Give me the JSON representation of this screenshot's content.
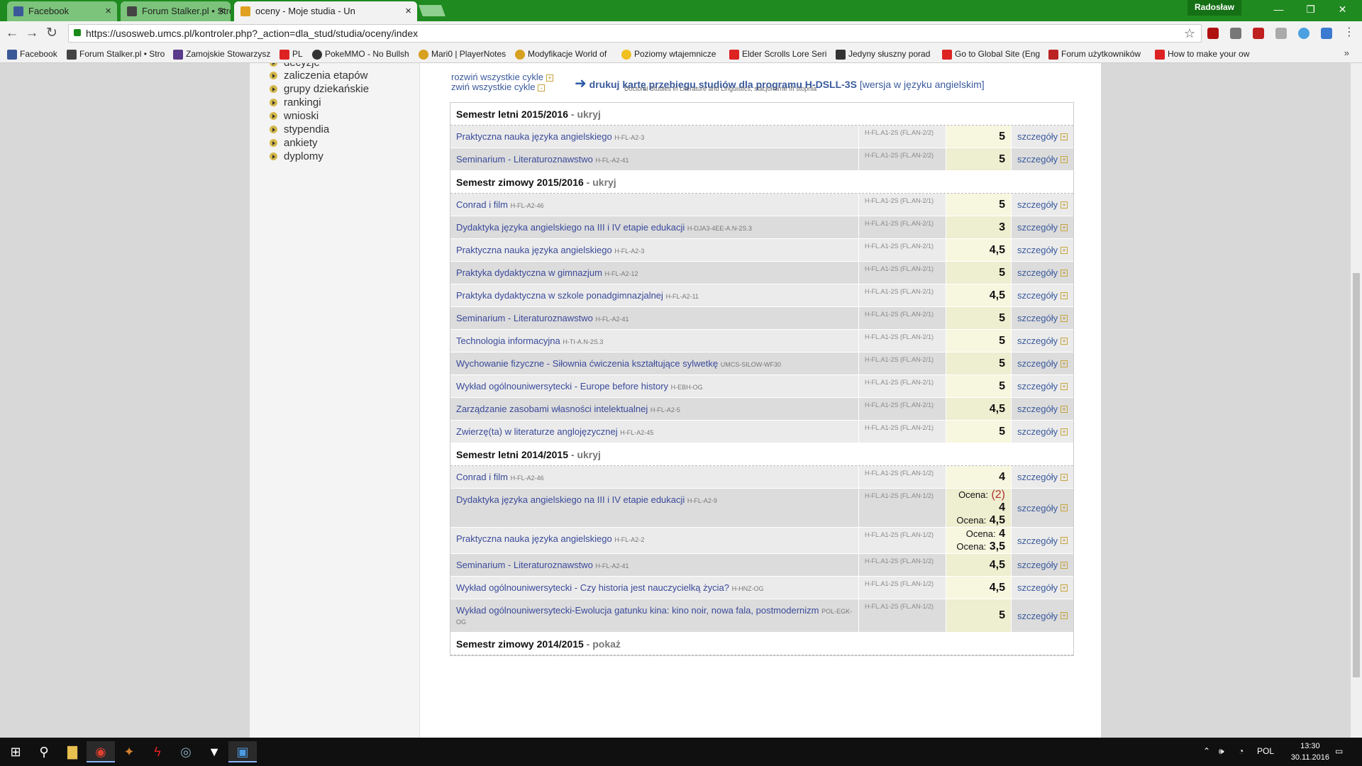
{
  "browser": {
    "tabs": [
      {
        "title": "Facebook",
        "icon_color": "#3b5998",
        "active": false
      },
      {
        "title": "Forum Stalker.pl • Strona",
        "icon_color": "#444444",
        "active": false
      },
      {
        "title": "oceny - Moje studia - Un",
        "icon_color": "#e0a020",
        "active": true
      }
    ],
    "user": "Radosław",
    "url": "https://usosweb.umcs.pl/kontroler.php?_action=dla_stud/studia/oceny/index",
    "bookmarks": [
      {
        "label": "Facebook",
        "color": "#3b5998"
      },
      {
        "label": "Forum Stalker.pl • Stro",
        "color": "#444444"
      },
      {
        "label": "Zamojskie Stowarzysz",
        "color": "#5a3a8a"
      },
      {
        "label": "PL",
        "color": "#d22"
      },
      {
        "label": "PokeMMO - No Bullsh",
        "color": "#333"
      },
      {
        "label": "Mari0 | PlayerNotes",
        "color": "#d8a020"
      },
      {
        "label": "Modyfikacje World of",
        "color": "#d8a020"
      },
      {
        "label": "Poziomy wtajemnicze",
        "color": "#f0c020"
      },
      {
        "label": "Elder Scrolls Lore Seri",
        "color": "#d22"
      },
      {
        "label": "Jedyny słuszny porad",
        "color": "#333"
      },
      {
        "label": "Go to Global Site (Eng",
        "color": "#d22"
      },
      {
        "label": "Forum użytkowników",
        "color": "#b22"
      },
      {
        "label": "How to make your ow",
        "color": "#d22"
      }
    ],
    "bookmarks_more": "»"
  },
  "sidebar": {
    "items": [
      {
        "label": "decyzje"
      },
      {
        "label": "zaliczenia etapów"
      },
      {
        "label": "grupy dziekańskie"
      },
      {
        "label": "rankingi"
      },
      {
        "label": "wnioski"
      },
      {
        "label": "stypendia"
      },
      {
        "label": "ankiety"
      },
      {
        "label": "dyplomy"
      }
    ]
  },
  "links": {
    "expand_all": "rozwiń wszystkie cykle",
    "collapse_all": "zwiń wszystkie cykle",
    "print_arrow": "➜",
    "print_main": "drukuj kartę przebiegu studiów dla programu H-DSLL-3S",
    "print_english": "[wersja w języku angielskim]",
    "print_sub": "Doctoral Studies in Literature and Linguistics, stacjonarne III stopnia"
  },
  "semesters": [
    {
      "title": "Semestr letni 2015/2016",
      "sep": " - ",
      "toggle": "ukryj",
      "courses": [
        {
          "name": "Praktyczna nauka języka angielskiego",
          "code": "H-FL-A2-3",
          "cycle": "H-FL.A1-2S (FL.AN-2/2)",
          "grades": [
            {
              "label": "",
              "value": "5"
            }
          ],
          "details": "szczegóły"
        },
        {
          "name": "Seminarium - Literaturoznawstwo",
          "code": "H-FL-A2-41",
          "cycle": "H-FL.A1-2S (FL.AN-2/2)",
          "grades": [
            {
              "label": "",
              "value": "5"
            }
          ],
          "details": "szczegóły"
        }
      ]
    },
    {
      "title": "Semestr zimowy 2015/2016",
      "sep": " - ",
      "toggle": "ukryj",
      "courses": [
        {
          "name": "Conrad i film",
          "code": "H-FL-A2-46",
          "cycle": "H-FL.A1-2S (FL.AN-2/1)",
          "grades": [
            {
              "label": "",
              "value": "5"
            }
          ],
          "details": "szczegóły"
        },
        {
          "name": "Dydaktyka języka angielskiego na III i IV etapie edukacji",
          "code": "H-DJA3-4EE-A.N-2S.3",
          "cycle": "H-FL.A1-2S (FL.AN-2/1)",
          "grades": [
            {
              "label": "",
              "value": "3"
            }
          ],
          "details": "szczegóły"
        },
        {
          "name": "Praktyczna nauka języka angielskiego",
          "code": "H-FL-A2-3",
          "cycle": "H-FL.A1-2S (FL.AN-2/1)",
          "grades": [
            {
              "label": "",
              "value": "4,5"
            }
          ],
          "details": "szczegóły"
        },
        {
          "name": "Praktyka dydaktyczna w gimnazjum",
          "code": "H-FL-A2-12",
          "cycle": "H-FL.A1-2S (FL.AN-2/1)",
          "grades": [
            {
              "label": "",
              "value": "5"
            }
          ],
          "details": "szczegóły"
        },
        {
          "name": "Praktyka dydaktyczna w szkole ponadgimnazjalnej",
          "code": "H-FL-A2-11",
          "cycle": "H-FL.A1-2S (FL.AN-2/1)",
          "grades": [
            {
              "label": "",
              "value": "4,5"
            }
          ],
          "details": "szczegóły"
        },
        {
          "name": "Seminarium - Literaturoznawstwo",
          "code": "H-FL-A2-41",
          "cycle": "H-FL.A1-2S (FL.AN-2/1)",
          "grades": [
            {
              "label": "",
              "value": "5"
            }
          ],
          "details": "szczegóły"
        },
        {
          "name": "Technologia informacyjna",
          "code": "H-TI-A.N-2S.3",
          "cycle": "H-FL.A1-2S (FL.AN-2/1)",
          "grades": [
            {
              "label": "",
              "value": "5"
            }
          ],
          "details": "szczegóły"
        },
        {
          "name": "Wychowanie fizyczne - Siłownia ćwiczenia kształtujące sylwetkę",
          "code": "UMCS-SILOW-WF30",
          "cycle": "H-FL.A1-2S (FL.AN-2/1)",
          "grades": [
            {
              "label": "",
              "value": "5"
            }
          ],
          "details": "szczegóły"
        },
        {
          "name": "Wykład ogólnouniwersytecki - Europe before history",
          "code": "H-EBH-OG",
          "cycle": "H-FL.A1-2S (FL.AN-2/1)",
          "grades": [
            {
              "label": "",
              "value": "5"
            }
          ],
          "details": "szczegóły"
        },
        {
          "name": "Zarządzanie zasobami własności intelektualnej",
          "code": "H-FL-A2-5",
          "cycle": "H-FL.A1-2S (FL.AN-2/1)",
          "grades": [
            {
              "label": "",
              "value": "4,5"
            }
          ],
          "details": "szczegóły"
        },
        {
          "name": "Zwierzę(ta) w literaturze anglojęzycznej",
          "code": "H-FL-A2-45",
          "cycle": "H-FL.A1-2S (FL.AN-2/1)",
          "grades": [
            {
              "label": "",
              "value": "5"
            }
          ],
          "details": "szczegóły"
        }
      ]
    },
    {
      "title": "Semestr letni 2014/2015",
      "sep": " - ",
      "toggle": "ukryj",
      "courses": [
        {
          "name": "Conrad i film",
          "code": "H-FL-A2-46",
          "cycle": "H-FL.A1-2S (FL.AN-1/2)",
          "grades": [
            {
              "label": "",
              "value": "4"
            }
          ],
          "details": "szczegóły"
        },
        {
          "name": "Dydaktyka języka angielskiego na III i IV etapie edukacji",
          "code": "H-FL-A2-9",
          "cycle": "H-FL.A1-2S (FL.AN-1/2)",
          "grades": [
            {
              "label": "Ocena:",
              "attempt": "(2)",
              "value": "4"
            },
            {
              "label": "Ocena:",
              "value": "4,5"
            }
          ],
          "details": "szczegóły"
        },
        {
          "name": "Praktyczna nauka języka angielskiego",
          "code": "H-FL-A2-2",
          "cycle": "H-FL.A1-2S (FL.AN-1/2)",
          "grades": [
            {
              "label": "Ocena:",
              "value": "4"
            },
            {
              "label": "Ocena:",
              "value": "3,5"
            }
          ],
          "details": "szczegóły"
        },
        {
          "name": "Seminarium - Literaturoznawstwo",
          "code": "H-FL-A2-41",
          "cycle": "H-FL.A1-2S (FL.AN-1/2)",
          "grades": [
            {
              "label": "",
              "value": "4,5"
            }
          ],
          "details": "szczegóły"
        },
        {
          "name": "Wykład ogólnouniwersytecki - Czy historia jest nauczycielką życia?",
          "code": "H-HNZ-OG",
          "cycle": "H-FL.A1-2S (FL.AN-1/2)",
          "grades": [
            {
              "label": "",
              "value": "4,5"
            }
          ],
          "details": "szczegóły"
        },
        {
          "name": "Wykład ogólnouniwersytecki-Ewolucja gatunku kina: kino noir, nowa fala, postmodernizm",
          "code": "POL-EGK-OG",
          "cycle": "H-FL.A1-2S (FL.AN-1/2)",
          "grades": [
            {
              "label": "",
              "value": "5"
            }
          ],
          "details": "szczegóły"
        }
      ]
    },
    {
      "title": "Semestr zimowy 2014/2015",
      "sep": " - ",
      "toggle": "pokaż",
      "courses": []
    }
  ],
  "taskbar": {
    "lang": "POL",
    "time": "13:30",
    "date": "30.11.2016"
  }
}
